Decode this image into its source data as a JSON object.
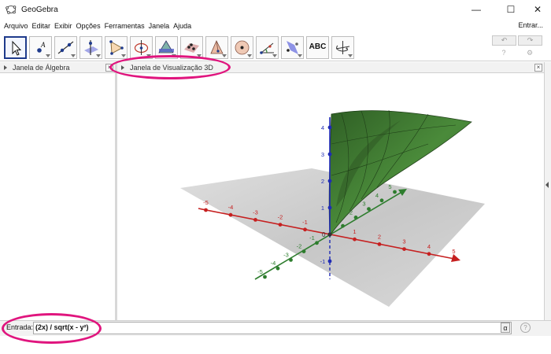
{
  "window": {
    "title": "GeoGebra",
    "minimize": "—",
    "maximize": "☐",
    "close": "✕"
  },
  "menu": {
    "items": [
      "Arquivo",
      "Editar",
      "Exibir",
      "Opções",
      "Ferramentas",
      "Janela",
      "Ajuda"
    ],
    "sign_in": "Entrar..."
  },
  "toolbar": {
    "tools": [
      {
        "name": "move-tool",
        "icon": "cursor-icon"
      },
      {
        "name": "point-tool",
        "icon": "point-a-icon"
      },
      {
        "name": "line-tool",
        "icon": "line-icon"
      },
      {
        "name": "perpendicular-tool",
        "icon": "perpendicular-line-icon"
      },
      {
        "name": "polygon-tool",
        "icon": "polygon-icon"
      },
      {
        "name": "circle-tool",
        "icon": "circle-axis-icon"
      },
      {
        "name": "intersect-surfaces-tool",
        "icon": "intersect-surfaces-icon"
      },
      {
        "name": "plane-tool",
        "icon": "plane-points-icon"
      },
      {
        "name": "pyramid-tool",
        "icon": "pyramid-icon"
      },
      {
        "name": "sphere-tool",
        "icon": "sphere-icon"
      },
      {
        "name": "angle-tool",
        "icon": "angle-icon"
      },
      {
        "name": "reflect-tool",
        "icon": "reflect-plane-icon"
      },
      {
        "name": "text-tool",
        "icon": "text-icon",
        "label": "ABC"
      },
      {
        "name": "rotate-view-tool",
        "icon": "rotate-view-icon"
      }
    ],
    "undo": "↶",
    "redo": "↷",
    "help_icon": "?",
    "settings_icon": "⚙"
  },
  "panels": {
    "algebra_title": "Janela de Álgebra",
    "view3d_title": "Janela de Visualização 3D",
    "close": "×"
  },
  "axes": {
    "x_ticks": [
      "-5",
      "-4",
      "-3",
      "-2",
      "-1",
      "1",
      "2",
      "3",
      "4",
      "5"
    ],
    "y_ticks": [
      "-5",
      "-4",
      "-3",
      "-2",
      "-1",
      "1",
      "2",
      "3",
      "4",
      "5"
    ],
    "z_ticks": [
      "-1",
      "1",
      "2",
      "3",
      "4"
    ],
    "origin": "0",
    "colors": {
      "x": "#c62020",
      "y": "#2e7d2e",
      "z": "#1f2bb5",
      "surface": "#3f7a30",
      "plane": "#b8b8b8"
    }
  },
  "input": {
    "label": "Entrada:",
    "value": "(2x) / sqrt(x - y²)",
    "alpha": "α",
    "help": "?"
  }
}
